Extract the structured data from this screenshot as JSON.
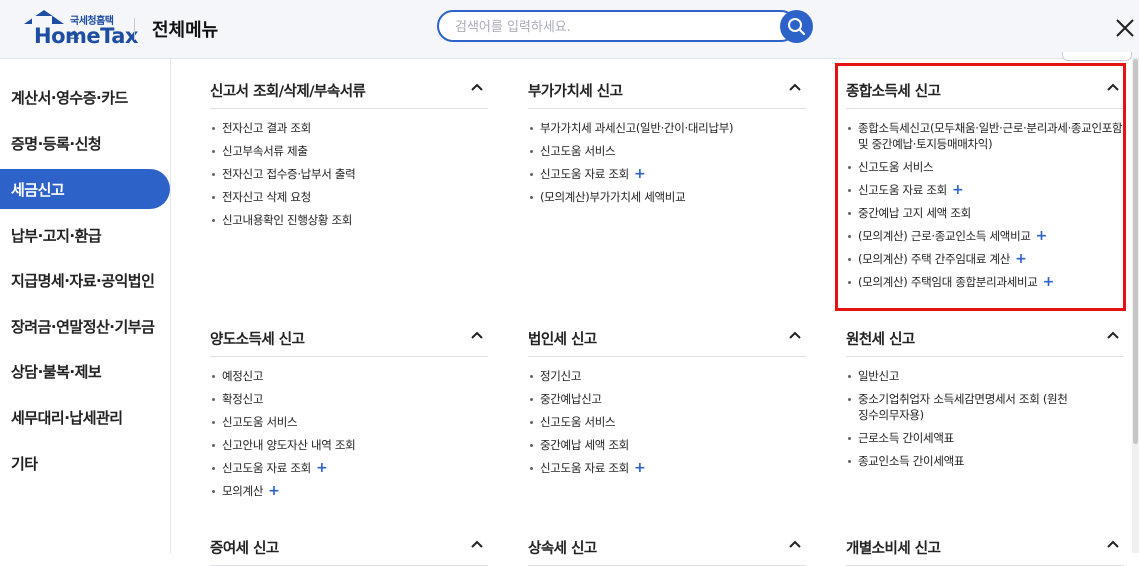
{
  "header": {
    "logo_small": "국세청홈택스",
    "logo_main": "HomeTax",
    "title": "전체메뉴",
    "search_placeholder": "검색어를 입력하세요.",
    "search_icon": "search-icon",
    "close_icon": "close-icon"
  },
  "sidebar": {
    "items": [
      {
        "label": "계산서·영수증·카드"
      },
      {
        "label": "증명·등록·신청"
      },
      {
        "label": "세금신고",
        "active": true
      },
      {
        "label": "납부·고지·환급"
      },
      {
        "label": "지급명세·자료·공익법인"
      },
      {
        "label": "장려금·연말정산·기부금"
      },
      {
        "label": "상담·불복·제보"
      },
      {
        "label": "세무대리·납세관리"
      },
      {
        "label": "기타"
      }
    ]
  },
  "sections": [
    {
      "title": "신고서 조회/삭제/부속서류",
      "items": [
        {
          "label": "전자신고 결과 조회"
        },
        {
          "label": "신고부속서류 제출"
        },
        {
          "label": "전자신고 접수증·납부서 출력"
        },
        {
          "label": "전자신고 삭제 요청"
        },
        {
          "label": "신고내용확인 진행상황 조회"
        }
      ]
    },
    {
      "title": "부가가치세 신고",
      "items": [
        {
          "label": "부가가치세 과세신고(일반·간이·대리납부)"
        },
        {
          "label": "신고도움 서비스"
        },
        {
          "label": "신고도움 자료 조회",
          "plus": "+"
        },
        {
          "label": "(모의계산)부가가치세 세액비교"
        }
      ]
    },
    {
      "title": "종합소득세 신고",
      "items": [
        {
          "label": "종합소득세신고(모두채움·일반·근로·분리과세·종교인포함 및 중간예납·토지등매매차익)"
        },
        {
          "label": "신고도움 서비스"
        },
        {
          "label": "신고도움 자료 조회",
          "plus": "+"
        },
        {
          "label": "중간예납 고지 세액 조회"
        },
        {
          "label": "(모의계산) 근로·종교인소득 세액비교",
          "plus": "+"
        },
        {
          "label": "(모의계산) 주택 간주임대료 계산",
          "plus": "+"
        },
        {
          "label": "(모의계산) 주택임대 종합분리과세비교",
          "plus": "+"
        }
      ]
    },
    {
      "title": "양도소득세 신고",
      "items": [
        {
          "label": "예정신고"
        },
        {
          "label": "확정신고"
        },
        {
          "label": "신고도움 서비스"
        },
        {
          "label": "신고안내 양도자산 내역 조회"
        },
        {
          "label": "신고도움 자료 조회",
          "plus": "+"
        },
        {
          "label": "모의계산",
          "plus": "+"
        }
      ]
    },
    {
      "title": "법인세 신고",
      "items": [
        {
          "label": "정기신고"
        },
        {
          "label": "중간예납신고"
        },
        {
          "label": "신고도움 서비스"
        },
        {
          "label": "중간예납 세액 조회"
        },
        {
          "label": "신고도움 자료 조회",
          "plus": "+"
        }
      ]
    },
    {
      "title": "원천세 신고",
      "items": [
        {
          "label": "일반신고"
        },
        {
          "label": "중소기업취업자 소득세감면명세서 조회 (원천징수의무자용)"
        },
        {
          "label": "근로소득 간이세액표"
        },
        {
          "label": "종교인소득 간이세액표"
        }
      ]
    },
    {
      "title": "증여세 신고",
      "items": []
    },
    {
      "title": "상속세 신고",
      "items": []
    },
    {
      "title": "개별소비세 신고",
      "items": []
    }
  ],
  "colors": {
    "accent": "#2d62c8",
    "highlight": "#e41212"
  }
}
